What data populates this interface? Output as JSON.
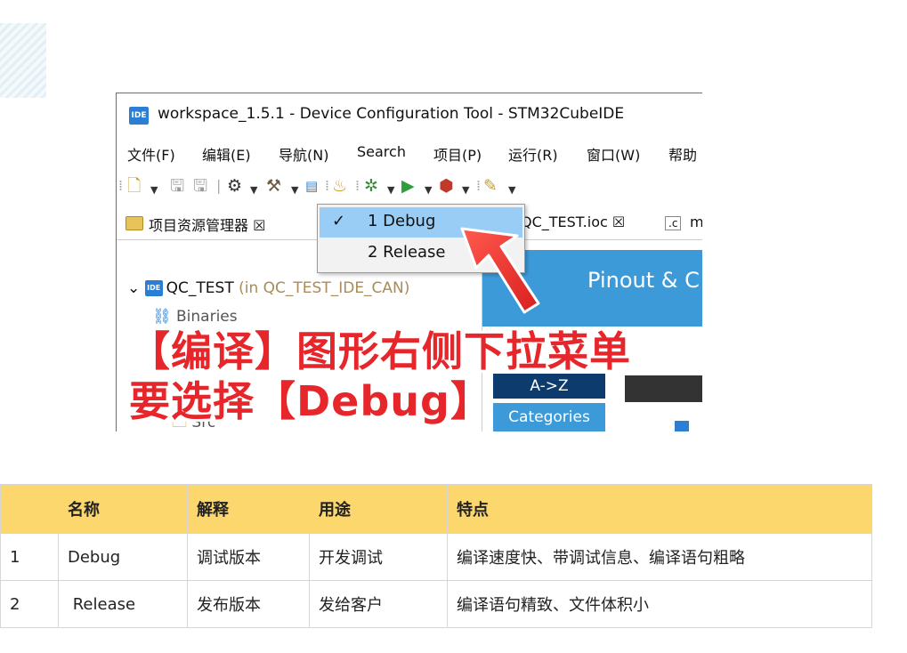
{
  "ide": {
    "window_title": "workspace_1.5.1 - Device Configuration Tool - STM32CubeIDE",
    "logo_text": "IDE",
    "menu": [
      "文件(F)",
      "编辑(E)",
      "导航(N)",
      "Search",
      "项目(P)",
      "运行(R)",
      "窗口(W)",
      "帮助"
    ],
    "tabs": {
      "project_explorer": "项目资源管理器 ☒",
      "ioc_file": "QC_TEST.ioc ☒",
      "next_tab": "m"
    },
    "tree": {
      "project_name": "QC_TEST",
      "project_suffix": "(in QC_TEST_IDE_CAN)",
      "binaries": "Binaries",
      "src": "Src"
    },
    "build_dropdown": {
      "items": [
        {
          "label": "1 Debug",
          "checked": true
        },
        {
          "label": "2 Release",
          "checked": false
        }
      ]
    },
    "pinout": {
      "title": "Pinout & C",
      "az": "A->Z",
      "categories": "Categories"
    },
    "icons": [
      "new-file-icon",
      "save-icon",
      "save-all-icon",
      "build-settings-icon",
      "build-hammer-icon",
      "binary-icon",
      "external-tools-icon",
      "debug-bug-icon",
      "run-icon",
      "run-config-icon",
      "pen-tool-icon"
    ]
  },
  "annotation": {
    "line1": "【编译】图形右侧下拉菜单",
    "line2": "要选择【Debug】",
    "arrow_color": "#e6262a"
  },
  "table": {
    "headers": [
      "",
      "名称",
      "解释",
      "用途",
      "特点"
    ],
    "rows": [
      [
        "1",
        "Debug",
        "调试版本",
        "开发调试",
        "编译速度快、带调试信息、编译语句粗略"
      ],
      [
        "2",
        " Release",
        "发布版本",
        "发给客户",
        "编译语句精致、文件体积小"
      ]
    ],
    "header_color": "#fbd76d"
  }
}
